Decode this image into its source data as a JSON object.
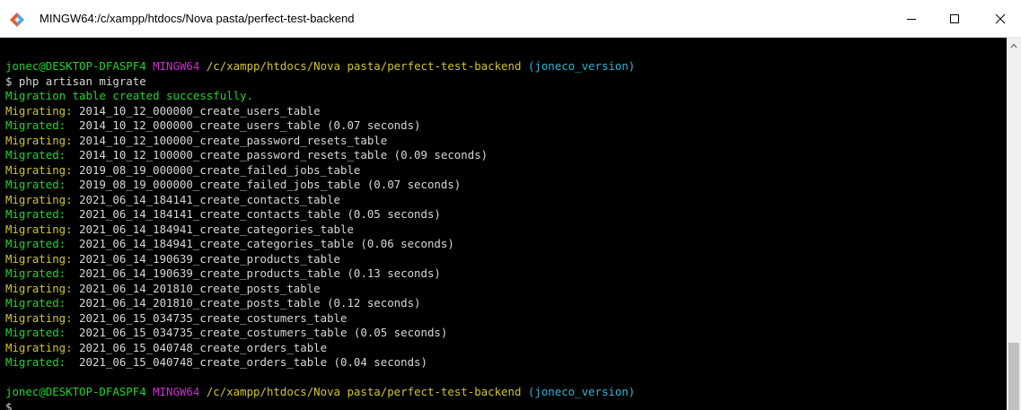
{
  "window": {
    "title": "MINGW64:/c/xampp/htdocs/Nova pasta/perfect-test-backend",
    "icon": "git-bash-icon",
    "controls": [
      "minimize-icon",
      "maximize-icon",
      "close-icon"
    ]
  },
  "colors": {
    "user": "#1bd82b",
    "mingw": "#cc2ed0",
    "path": "#d0c52a",
    "branch": "#27b8d6",
    "migrating": "#d0c52a",
    "migrated": "#1bd82b"
  },
  "prompt1": {
    "user": "jonec@DESKTOP-DFASPF4",
    "mingw": "MINGW64",
    "path": "/c/xampp/htdocs/Nova pasta/perfect-test-backend",
    "branch": "(joneco_version)",
    "command": "$ php artisan migrate"
  },
  "output": {
    "created": "Migration table created successfully.",
    "lines": [
      {
        "status": "Migrating:",
        "text": " 2014_10_12_000000_create_users_table"
      },
      {
        "status": "Migrated:",
        "text": "  2014_10_12_000000_create_users_table (0.07 seconds)"
      },
      {
        "status": "Migrating:",
        "text": " 2014_10_12_100000_create_password_resets_table"
      },
      {
        "status": "Migrated:",
        "text": "  2014_10_12_100000_create_password_resets_table (0.09 seconds)"
      },
      {
        "status": "Migrating:",
        "text": " 2019_08_19_000000_create_failed_jobs_table"
      },
      {
        "status": "Migrated:",
        "text": "  2019_08_19_000000_create_failed_jobs_table (0.07 seconds)"
      },
      {
        "status": "Migrating:",
        "text": " 2021_06_14_184141_create_contacts_table"
      },
      {
        "status": "Migrated:",
        "text": "  2021_06_14_184141_create_contacts_table (0.05 seconds)"
      },
      {
        "status": "Migrating:",
        "text": " 2021_06_14_184941_create_categories_table"
      },
      {
        "status": "Migrated:",
        "text": "  2021_06_14_184941_create_categories_table (0.06 seconds)"
      },
      {
        "status": "Migrating:",
        "text": " 2021_06_14_190639_create_products_table"
      },
      {
        "status": "Migrated:",
        "text": "  2021_06_14_190639_create_products_table (0.13 seconds)"
      },
      {
        "status": "Migrating:",
        "text": " 2021_06_14_201810_create_posts_table"
      },
      {
        "status": "Migrated:",
        "text": "  2021_06_14_201810_create_posts_table (0.12 seconds)"
      },
      {
        "status": "Migrating:",
        "text": " 2021_06_15_034735_create_costumers_table"
      },
      {
        "status": "Migrated:",
        "text": "  2021_06_15_034735_create_costumers_table (0.05 seconds)"
      },
      {
        "status": "Migrating:",
        "text": " 2021_06_15_040748_create_orders_table"
      },
      {
        "status": "Migrated:",
        "text": "  2021_06_15_040748_create_orders_table (0.04 seconds)"
      }
    ]
  },
  "prompt2": {
    "user": "jonec@DESKTOP-DFASPF4",
    "mingw": "MINGW64",
    "path": "/c/xampp/htdocs/Nova pasta/perfect-test-backend",
    "branch": "(joneco_version)",
    "command": "$"
  }
}
